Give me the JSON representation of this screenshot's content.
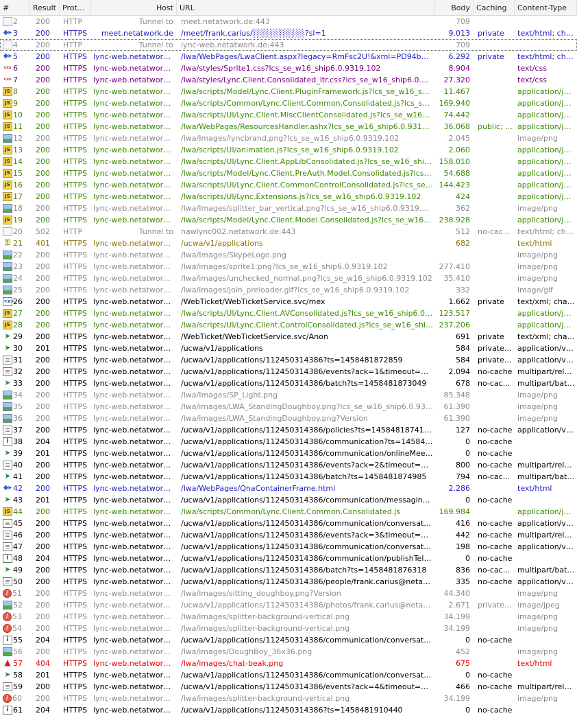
{
  "colors": {
    "tunnel": "#8a8a8a",
    "html": "#2020c0",
    "css": "#7a0080",
    "js": "#3a8a00",
    "image": "#8a8a8a",
    "auth": "#8a7400",
    "normal": "#000000",
    "error": "#e00000"
  },
  "columns": [
    "#",
    "Result",
    "Prot...",
    "Host",
    "URL",
    "Body",
    "Caching",
    "Content-Type"
  ],
  "rows": [
    {
      "icon": "tunnel",
      "kind": "tunnel",
      "n": "2",
      "result": "200",
      "proto": "HTTP",
      "host": "Tunnel to",
      "url": "meet.netatwork.de:443",
      "body": "709",
      "caching": "",
      "ctype": ""
    },
    {
      "icon": "html",
      "kind": "html",
      "n": "3",
      "result": "200",
      "proto": "HTTPS",
      "host": "meet.netatwork.de",
      "url": "/meet/frank.carius/░░░░░░░░░?sl=1",
      "body": "9.013",
      "caching": "private",
      "ctype": "text/html; cha..."
    },
    {
      "icon": "tunnel",
      "kind": "tunnel",
      "n": "4",
      "result": "200",
      "proto": "HTTP",
      "host": "Tunnel to",
      "url": "lync-web.netatwork.de:443",
      "body": "709",
      "caching": "",
      "ctype": "",
      "selected": true
    },
    {
      "icon": "html",
      "kind": "html",
      "n": "5",
      "result": "200",
      "proto": "HTTPS",
      "host": "lync-web.netatwork.de",
      "url": "/lwa/WebPages/LwaClient.aspx?legacy=RmFsc2U!&xml=PD94bWwgdmVy...",
      "body": "6.292",
      "caching": "private",
      "ctype": "text/html; cha..."
    },
    {
      "icon": "css",
      "kind": "css",
      "n": "6",
      "result": "200",
      "proto": "HTTPS",
      "host": "lync-web.netatwork.de",
      "url": "/lwa/styles/Sprite1.css?lcs_se_w16_ship6.0.9319.102",
      "body": "8.904",
      "caching": "",
      "ctype": "text/css"
    },
    {
      "icon": "css",
      "kind": "css",
      "n": "7",
      "result": "200",
      "proto": "HTTPS",
      "host": "lync-web.netatwork.de",
      "url": "/lwa/styles/Lync.Client.Consolidated_ltr.css?lcs_se_w16_ship6.0.9319.102",
      "body": "27.320",
      "caching": "",
      "ctype": "text/css"
    },
    {
      "icon": "js",
      "kind": "js",
      "n": "8",
      "result": "200",
      "proto": "HTTPS",
      "host": "lync-web.netatwork.de",
      "url": "/lwa/scripts/Model/Lync.Client.PluginFramework.js?lcs_se_w16_ship6.0.9319.102",
      "body": "11.467",
      "caching": "",
      "ctype": "application/ja..."
    },
    {
      "icon": "js",
      "kind": "js",
      "n": "9",
      "result": "200",
      "proto": "HTTPS",
      "host": "lync-web.netatwork.de",
      "url": "/lwa/scripts/Common/Lync.Client.Common.Consolidated.js?lcs_se_w16_ship6.0.9319.102",
      "body": "169.940",
      "caching": "",
      "ctype": "application/ja..."
    },
    {
      "icon": "js",
      "kind": "js",
      "n": "10",
      "result": "200",
      "proto": "HTTPS",
      "host": "lync-web.netatwork.de",
      "url": "/lwa/scripts/UI/Lync.Client.MiscClientConsolidated.js?lcs_se_w16_ship6.0.9319.102",
      "body": "74.442",
      "caching": "",
      "ctype": "application/ja..."
    },
    {
      "icon": "js",
      "kind": "js",
      "n": "11",
      "result": "200",
      "proto": "HTTPS",
      "host": "lync-web.netatwork.de",
      "url": "/lwa/WebPages/ResourcesHandler.ashx?lcs_se_w16_ship6.0.9319.102&r...",
      "body": "36.068",
      "caching": "public; ...",
      "ctype": "application/ja..."
    },
    {
      "icon": "img",
      "kind": "image",
      "n": "12",
      "result": "200",
      "proto": "HTTPS",
      "host": "lync-web.netatwork.de",
      "url": "/lwa/Images/lyncbrand.png?lcs_se_w16_ship6.0.9319.102",
      "body": "2.045",
      "caching": "",
      "ctype": "image/png"
    },
    {
      "icon": "js",
      "kind": "js",
      "n": "13",
      "result": "200",
      "proto": "HTTPS",
      "host": "lync-web.netatwork.de",
      "url": "/lwa/scripts/UI/animation.js?lcs_se_w16_ship6.0.9319.102",
      "body": "2.060",
      "caching": "",
      "ctype": "application/ja..."
    },
    {
      "icon": "js",
      "kind": "js",
      "n": "14",
      "result": "200",
      "proto": "HTTPS",
      "host": "lync-web.netatwork.de",
      "url": "/lwa/scripts/UI/Lync.Client.AppLibConsolidated.js?lcs_se_w16_ship6.0.9319.102",
      "body": "158.010",
      "caching": "",
      "ctype": "application/ja..."
    },
    {
      "icon": "js",
      "kind": "js",
      "n": "15",
      "result": "200",
      "proto": "HTTPS",
      "host": "lync-web.netatwork.de",
      "url": "/lwa/scripts/Model/Lync.Client.PreAuth.Model.Consolidated.js?lcs_se_w16_ship6.0.9319.102",
      "body": "54.688",
      "caching": "",
      "ctype": "application/ja..."
    },
    {
      "icon": "js",
      "kind": "js",
      "n": "16",
      "result": "200",
      "proto": "HTTPS",
      "host": "lync-web.netatwork.de",
      "url": "/lwa/scripts/UI/Lync.Client.CommonControlConsolidated.js?lcs_se_w16_ship6.0.9319.102",
      "body": "144.423",
      "caching": "",
      "ctype": "application/ja..."
    },
    {
      "icon": "js",
      "kind": "js",
      "n": "17",
      "result": "200",
      "proto": "HTTPS",
      "host": "lync-web.netatwork.de",
      "url": "/lwa/scripts/UI/Lync.Extensions.js?lcs_se_w16_ship6.0.9319.102",
      "body": "424",
      "caching": "",
      "ctype": "application/ja..."
    },
    {
      "icon": "img",
      "kind": "image",
      "n": "18",
      "result": "200",
      "proto": "HTTPS",
      "host": "lync-web.netatwork.de",
      "url": "/lwa/Images/splitter_bar_vertical.png?lcs_se_w16_ship6.0.9319.102",
      "body": "362",
      "caching": "",
      "ctype": "image/png"
    },
    {
      "icon": "js",
      "kind": "js",
      "n": "19",
      "result": "200",
      "proto": "HTTPS",
      "host": "lync-web.netatwork.de",
      "url": "/lwa/scripts/Model/Lync.Client.Model.Consolidated.js?lcs_se_w16_ship6.0.9319.102",
      "body": "238.928",
      "caching": "",
      "ctype": "application/ja..."
    },
    {
      "icon": "tunnel",
      "kind": "tunnel",
      "n": "20",
      "result": "502",
      "proto": "HTTP",
      "host": "Tunnel to",
      "url": "nawlync002.netatwork.de:443",
      "body": "512",
      "caching": "no-cac...",
      "ctype": "text/html; cha..."
    },
    {
      "icon": "lock",
      "kind": "auth",
      "n": "21",
      "result": "401",
      "proto": "HTTPS",
      "host": "lync-web.netatwork.de",
      "url": "/ucwa/v1/applications",
      "body": "682",
      "caching": "",
      "ctype": "text/html"
    },
    {
      "icon": "img",
      "kind": "image",
      "n": "22",
      "result": "200",
      "proto": "HTTPS",
      "host": "lync-web.netatwork.de",
      "url": "/lwa/Images/SkypeLogo.png",
      "body": "",
      "caching": "",
      "ctype": "image/png"
    },
    {
      "icon": "img",
      "kind": "image",
      "n": "23",
      "result": "200",
      "proto": "HTTPS",
      "host": "lync-web.netatwork.de",
      "url": "/lwa/images/sprite1.png?lcs_se_w16_ship6.0.9319.102",
      "body": "277.410",
      "caching": "",
      "ctype": "image/png"
    },
    {
      "icon": "img",
      "kind": "image",
      "n": "24",
      "result": "200",
      "proto": "HTTPS",
      "host": "lync-web.netatwork.de",
      "url": "/lwa/images/unchecked_normal.png?lcs_se_w16_ship6.0.9319.102",
      "body": "35.410",
      "caching": "",
      "ctype": "image/png"
    },
    {
      "icon": "img",
      "kind": "image",
      "n": "25",
      "result": "200",
      "proto": "HTTPS",
      "host": "lync-web.netatwork.de",
      "url": "/lwa/images/join_preloader.gif?lcs_se_w16_ship6.0.9319.102",
      "body": "332",
      "caching": "",
      "ctype": "image/gif"
    },
    {
      "icon": "xml",
      "kind": "normal",
      "n": "26",
      "result": "200",
      "proto": "HTTPS",
      "host": "lync-web.netatwork.de",
      "url": "/WebTicket/WebTicketService.svc/mex",
      "body": "1.662",
      "caching": "private",
      "ctype": "text/xml; char..."
    },
    {
      "icon": "js",
      "kind": "js",
      "n": "27",
      "result": "200",
      "proto": "HTTPS",
      "host": "lync-web.netatwork.de",
      "url": "/lwa/scripts/UI/Lync.Client.AVConsolidated.js?lcs_se_w16_ship6.0.9319....",
      "body": "123.517",
      "caching": "",
      "ctype": "application/ja..."
    },
    {
      "icon": "js",
      "kind": "js",
      "n": "28",
      "result": "200",
      "proto": "HTTPS",
      "host": "lync-web.netatwork.de",
      "url": "/lwa/scripts/UI/Lync.Client.ControlConsolidated.js?lcs_se_w16_ship6.0.9319....",
      "body": "237.206",
      "caching": "",
      "ctype": "application/ja..."
    },
    {
      "icon": "post",
      "kind": "normal",
      "n": "29",
      "result": "200",
      "proto": "HTTPS",
      "host": "lync-web.netatwork.de",
      "url": "/WebTicket/WebTicketService.svc/Anon",
      "body": "691",
      "caching": "private",
      "ctype": "text/xml; char..."
    },
    {
      "icon": "post",
      "kind": "normal",
      "n": "30",
      "result": "201",
      "proto": "HTTPS",
      "host": "lync-web.netatwork.de",
      "url": "/ucwa/v1/applications",
      "body": "584",
      "caching": "private...",
      "ctype": "application/vn..."
    },
    {
      "icon": "doc",
      "kind": "normal",
      "n": "31",
      "result": "200",
      "proto": "HTTPS",
      "host": "lync-web.netatwork.de",
      "url": "/ucwa/v1/applications/112450314386?ts=1458481872859",
      "body": "584",
      "caching": "private...",
      "ctype": "application/vn..."
    },
    {
      "icon": "doc",
      "kind": "normal",
      "n": "32",
      "result": "200",
      "proto": "HTTPS",
      "host": "lync-web.netatwork.de",
      "url": "/ucwa/v1/applications/112450314386/events?ack=1&timeout=180&ts=1...",
      "body": "2.094",
      "caching": "no-cache",
      "ctype": "multipart/relat..."
    },
    {
      "icon": "post",
      "kind": "normal",
      "n": "33",
      "result": "200",
      "proto": "HTTPS",
      "host": "lync-web.netatwork.de",
      "url": "/ucwa/v1/applications/112450314386/batch?ts=1458481873049",
      "body": "678",
      "caching": "no-cac...",
      "ctype": "multipart/batc..."
    },
    {
      "icon": "img",
      "kind": "image",
      "n": "34",
      "result": "200",
      "proto": "HTTPS",
      "host": "lync-web.netatwork.de",
      "url": "/lwa/Images/SP_Light.png",
      "body": "85.348",
      "caching": "",
      "ctype": "image/png"
    },
    {
      "icon": "img",
      "kind": "image",
      "n": "35",
      "result": "200",
      "proto": "HTTPS",
      "host": "lync-web.netatwork.de",
      "url": "/lwa/images/LWA_StandingDoughboy.png?lcs_se_w16_ship6.0.9319.102",
      "body": "61.390",
      "caching": "",
      "ctype": "image/png"
    },
    {
      "icon": "img",
      "kind": "image",
      "n": "36",
      "result": "200",
      "proto": "HTTPS",
      "host": "lync-web.netatwork.de",
      "url": "/lwa/images/LWA_StandingDoughboy.png?Version",
      "body": "61.390",
      "caching": "",
      "ctype": "image/png"
    },
    {
      "icon": "doc",
      "kind": "normal",
      "n": "37",
      "result": "200",
      "proto": "HTTPS",
      "host": "lync-web.netatwork.de",
      "url": "/ucwa/v1/applications/112450314386/policies?ts=1458481874108",
      "body": "127",
      "caching": "no-cache",
      "ctype": "application/vn..."
    },
    {
      "icon": "info",
      "kind": "normal",
      "n": "38",
      "result": "204",
      "proto": "HTTPS",
      "host": "lync-web.netatwork.de",
      "url": "/ucwa/v1/applications/112450314386/communication?ts=1458481874349",
      "body": "0",
      "caching": "no-cache",
      "ctype": ""
    },
    {
      "icon": "post",
      "kind": "normal",
      "n": "39",
      "result": "201",
      "proto": "HTTPS",
      "host": "lync-web.netatwork.de",
      "url": "/ucwa/v1/applications/112450314386/communication/onlineMeetingInvita...",
      "body": "0",
      "caching": "no-cache",
      "ctype": ""
    },
    {
      "icon": "doc",
      "kind": "normal",
      "n": "40",
      "result": "200",
      "proto": "HTTPS",
      "host": "lync-web.netatwork.de",
      "url": "/ucwa/v1/applications/112450314386/events?ack=2&timeout=180&ts=1...",
      "body": "800",
      "caching": "no-cache",
      "ctype": "multipart/relat..."
    },
    {
      "icon": "post",
      "kind": "normal",
      "n": "41",
      "result": "200",
      "proto": "HTTPS",
      "host": "lync-web.netatwork.de",
      "url": "/ucwa/v1/applications/112450314386/batch?ts=1458481874985",
      "body": "794",
      "caching": "no-cac...",
      "ctype": "multipart/batc..."
    },
    {
      "icon": "html",
      "kind": "html",
      "n": "42",
      "result": "200",
      "proto": "HTTPS",
      "host": "lync-web.netatwork.de",
      "url": "/lwa/WebPages/QnaContainerFrame.html",
      "body": "2.286",
      "caching": "",
      "ctype": "text/html"
    },
    {
      "icon": "post",
      "kind": "normal",
      "n": "43",
      "result": "201",
      "proto": "HTTPS",
      "host": "lync-web.netatwork.de",
      "url": "/ucwa/v1/applications/112450314386/communication/messagingInvitation...",
      "body": "0",
      "caching": "no-cache",
      "ctype": ""
    },
    {
      "icon": "js",
      "kind": "js",
      "n": "44",
      "result": "200",
      "proto": "HTTPS",
      "host": "lync-web.netatwork.de",
      "url": "/lwa/scripts/Common/Lync.Client.Common.Consolidated.js",
      "body": "169.984",
      "caching": "",
      "ctype": "application/ja..."
    },
    {
      "icon": "doc",
      "kind": "normal",
      "n": "45",
      "result": "200",
      "proto": "HTTPS",
      "host": "lync-web.netatwork.de",
      "url": "/ucwa/v1/applications/112450314386/communication/conversations/a0af...",
      "body": "416",
      "caching": "no-cache",
      "ctype": "application/vn..."
    },
    {
      "icon": "doc",
      "kind": "normal",
      "n": "46",
      "result": "200",
      "proto": "HTTPS",
      "host": "lync-web.netatwork.de",
      "url": "/ucwa/v1/applications/112450314386/events?ack=3&timeout=180&ts=1...",
      "body": "442",
      "caching": "no-cache",
      "ctype": "multipart/relat..."
    },
    {
      "icon": "doc",
      "kind": "normal",
      "n": "47",
      "result": "200",
      "proto": "HTTPS",
      "host": "lync-web.netatwork.de",
      "url": "/ucwa/v1/applications/112450314386/communication/conversations/a0af...",
      "body": "198",
      "caching": "no-cache",
      "ctype": "application/vn..."
    },
    {
      "icon": "info",
      "kind": "normal",
      "n": "48",
      "result": "204",
      "proto": "HTTPS",
      "host": "lync-web.netatwork.de",
      "url": "/ucwa/v1/applications/112450314386/communication/publishTelemetry?id...",
      "body": "0",
      "caching": "no-cache",
      "ctype": ""
    },
    {
      "icon": "post",
      "kind": "normal",
      "n": "49",
      "result": "200",
      "proto": "HTTPS",
      "host": "lync-web.netatwork.de",
      "url": "/ucwa/v1/applications/112450314386/batch?ts=1458481876318",
      "body": "836",
      "caching": "no-cac...",
      "ctype": "multipart/batc..."
    },
    {
      "icon": "doc",
      "kind": "normal",
      "n": "50",
      "result": "200",
      "proto": "HTTPS",
      "host": "lync-web.netatwork.de",
      "url": "/ucwa/v1/applications/112450314386/people/frank.carius@netatwork.de...",
      "body": "335",
      "caching": "no-cache",
      "ctype": "application/vn..."
    },
    {
      "icon": "block",
      "kind": "image",
      "n": "51",
      "result": "200",
      "proto": "HTTPS",
      "host": "lync-web.netatwork.de",
      "url": "/lwa/images/sitting_doughboy.png?Version",
      "body": "44.340",
      "caching": "",
      "ctype": "image/png"
    },
    {
      "icon": "img",
      "kind": "image",
      "n": "52",
      "result": "200",
      "proto": "HTTPS",
      "host": "lync-web.netatwork.de",
      "url": "/ucwa/v1/applications/112450314386/photos/frank.carius@netatwork.de...",
      "body": "2.671",
      "caching": "private...",
      "ctype": "image/jpeg"
    },
    {
      "icon": "block",
      "kind": "image",
      "n": "53",
      "result": "200",
      "proto": "HTTPS",
      "host": "lync-web.netatwork.de",
      "url": "/lwa/images/splitter-background-vertical.png",
      "body": "34.199",
      "caching": "",
      "ctype": "image/png"
    },
    {
      "icon": "block",
      "kind": "image",
      "n": "54",
      "result": "200",
      "proto": "HTTPS",
      "host": "lync-web.netatwork.de",
      "url": "/lwa/images/splitter-background-vertical.png",
      "body": "34.199",
      "caching": "",
      "ctype": "image/png"
    },
    {
      "icon": "info",
      "kind": "normal",
      "n": "55",
      "result": "204",
      "proto": "HTTPS",
      "host": "lync-web.netatwork.de",
      "url": "/ucwa/v1/applications/112450314386/communication/conversations/a0af...",
      "body": "0",
      "caching": "no-cache",
      "ctype": ""
    },
    {
      "icon": "img",
      "kind": "image",
      "n": "56",
      "result": "200",
      "proto": "HTTPS",
      "host": "lync-web.netatwork.de",
      "url": "/lwa/images/DoughBoy_36x36.png",
      "body": "452",
      "caching": "",
      "ctype": "image/png"
    },
    {
      "icon": "err",
      "kind": "error",
      "n": "57",
      "result": "404",
      "proto": "HTTPS",
      "host": "lync-web.netatwork.de",
      "url": "/lwa/images/chat-beak.png",
      "body": "675",
      "caching": "",
      "ctype": "text/html"
    },
    {
      "icon": "post",
      "kind": "normal",
      "n": "58",
      "result": "201",
      "proto": "HTTPS",
      "host": "lync-web.netatwork.de",
      "url": "/ucwa/v1/applications/112450314386/communication/conversations/a0af...",
      "body": "0",
      "caching": "no-cache",
      "ctype": ""
    },
    {
      "icon": "doc",
      "kind": "normal",
      "n": "59",
      "result": "200",
      "proto": "HTTPS",
      "host": "lync-web.netatwork.de",
      "url": "/ucwa/v1/applications/112450314386/events?ack=4&timeout=180&ts=1...",
      "body": "466",
      "caching": "no-cache",
      "ctype": "multipart/relat..."
    },
    {
      "icon": "block",
      "kind": "image",
      "n": "60",
      "result": "200",
      "proto": "HTTPS",
      "host": "lync-web.netatwork.de",
      "url": "/lwa/images/splitter-background-vertical.png",
      "body": "34.199",
      "caching": "",
      "ctype": "image/png"
    },
    {
      "icon": "info",
      "kind": "normal",
      "n": "61",
      "result": "204",
      "proto": "HTTPS",
      "host": "lync-web.netatwork.de",
      "url": "/ucwa/v1/applications/112450314386?ts=1458481910440",
      "body": "0",
      "caching": "no-cache",
      "ctype": ""
    }
  ]
}
